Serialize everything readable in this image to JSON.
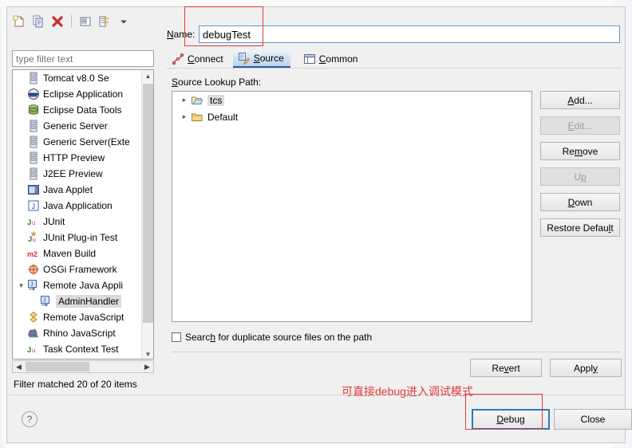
{
  "dialog": {
    "name_label": "Name:",
    "name_value": "debugTest",
    "help_icon": "question-mark-icon"
  },
  "toolbar": {
    "items": [
      {
        "name": "new-launch-configuration",
        "glyph": "new-page-icon"
      },
      {
        "name": "duplicate-launch-configuration",
        "glyph": "copy-icon"
      },
      {
        "name": "delete-launch-configuration",
        "glyph": "delete-x-icon"
      },
      {
        "name": "collapse-all",
        "glyph": "collapse-all-icon"
      },
      {
        "name": "filter-launch-configurations",
        "glyph": "filter-icon"
      },
      {
        "name": "view-menu",
        "glyph": "chevron-down-icon"
      }
    ]
  },
  "filter": {
    "placeholder": "type filter text",
    "value": "",
    "status": "Filter matched 20 of 20 items"
  },
  "tree": {
    "items": [
      {
        "label": "Tomcat v8.0 Se",
        "icon": "server-icon",
        "indent": 1,
        "twisty": "",
        "selected": false
      },
      {
        "label": "Eclipse Application",
        "icon": "eclipse-icon",
        "indent": 1,
        "twisty": "",
        "selected": false
      },
      {
        "label": "Eclipse Data Tools",
        "icon": "database-icon",
        "indent": 1,
        "twisty": "",
        "selected": false
      },
      {
        "label": "Generic Server",
        "icon": "server-icon",
        "indent": 1,
        "twisty": "",
        "selected": false
      },
      {
        "label": "Generic Server(Exte",
        "icon": "server-icon",
        "indent": 1,
        "twisty": "",
        "selected": false
      },
      {
        "label": "HTTP Preview",
        "icon": "server-icon",
        "indent": 1,
        "twisty": "",
        "selected": false
      },
      {
        "label": "J2EE Preview",
        "icon": "server-icon",
        "indent": 1,
        "twisty": "",
        "selected": false
      },
      {
        "label": "Java Applet",
        "icon": "java-applet-icon",
        "indent": 1,
        "twisty": "",
        "selected": false
      },
      {
        "label": "Java Application",
        "icon": "java-application-icon",
        "indent": 1,
        "twisty": "",
        "selected": false
      },
      {
        "label": "JUnit",
        "icon": "junit-icon",
        "indent": 1,
        "twisty": "",
        "selected": false
      },
      {
        "label": "JUnit Plug-in Test",
        "icon": "junit-plugin-icon",
        "indent": 1,
        "twisty": "",
        "selected": false
      },
      {
        "label": "Maven Build",
        "icon": "maven-icon",
        "indent": 1,
        "twisty": "",
        "selected": false
      },
      {
        "label": "OSGi Framework",
        "icon": "osgi-icon",
        "indent": 1,
        "twisty": "",
        "selected": false
      },
      {
        "label": "Remote Java Appli",
        "icon": "remote-java-icon",
        "indent": 0,
        "twisty": "expanded",
        "selected": false
      },
      {
        "label": "AdminHandler",
        "icon": "remote-java-icon",
        "indent": 2,
        "twisty": "",
        "selected": true
      },
      {
        "label": "Remote JavaScript",
        "icon": "remote-javascript-icon",
        "indent": 1,
        "twisty": "",
        "selected": false
      },
      {
        "label": "Rhino JavaScript",
        "icon": "rhino-icon",
        "indent": 1,
        "twisty": "",
        "selected": false
      },
      {
        "label": "Task Context Test",
        "icon": "junit-icon",
        "indent": 1,
        "twisty": "",
        "selected": false
      }
    ]
  },
  "tabs": [
    {
      "label": "Connect",
      "icon": "connect-icon",
      "active": false,
      "mnemonic": "C"
    },
    {
      "label": "Source",
      "icon": "source-icon",
      "active": true,
      "mnemonic": "S"
    },
    {
      "label": "Common",
      "icon": "common-icon",
      "active": false,
      "mnemonic": "C"
    }
  ],
  "source_tab": {
    "lookup_path_label": "Source Lookup Path:",
    "entries": [
      {
        "label": "tcs",
        "icon": "folder-open-icon",
        "twisty": "collapsed",
        "selected": true
      },
      {
        "label": "Default",
        "icon": "folder-icon",
        "twisty": "collapsed",
        "selected": false
      }
    ],
    "side_buttons": [
      {
        "label": "Add...",
        "name": "add-button",
        "enabled": true
      },
      {
        "label": "Edit...",
        "name": "edit-button",
        "enabled": false
      },
      {
        "label": "Remove",
        "name": "remove-button",
        "enabled": true
      },
      {
        "label": "Up",
        "name": "up-button",
        "enabled": false
      },
      {
        "label": "Down",
        "name": "down-button",
        "enabled": true
      },
      {
        "label": "Restore Default",
        "name": "restore-default-button",
        "enabled": true
      }
    ],
    "duplicate_checkbox": {
      "label": "Search for duplicate source files on the path",
      "checked": false
    }
  },
  "form_buttons": {
    "revert": "Revert",
    "apply": "Apply"
  },
  "footer_buttons": {
    "debug": "Debug",
    "close": "Close"
  },
  "annotations": {
    "note_text": "可直接debug进入调试模式",
    "color": "#e03a3a"
  }
}
